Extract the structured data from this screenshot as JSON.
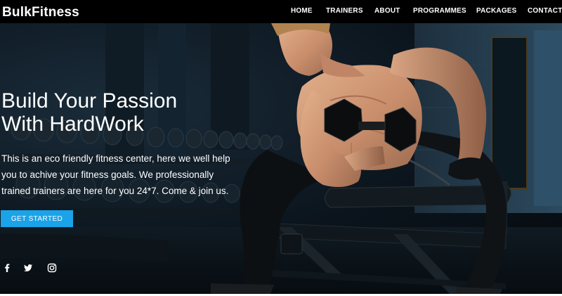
{
  "brand": {
    "name": "BulkFitness"
  },
  "nav": {
    "items": [
      {
        "label": "HOME"
      },
      {
        "label": "TRAINERS"
      },
      {
        "label": "ABOUT"
      },
      {
        "label": "PROGRAMMES"
      },
      {
        "label": "PACKAGES"
      },
      {
        "label": "CONTACT"
      }
    ]
  },
  "hero": {
    "title_line1": "Build Your Passion",
    "title_line2": "With HardWork",
    "text": "This is an eco friendly fitness center, here we well help you to achive your fitness goals. We professionally trained trainers are here for you 24*7. Come & join us.",
    "cta_label": "GET STARTED",
    "image_icon": "man-lifting-dumbbell-photo"
  },
  "social": {
    "icons": [
      "facebook-icon",
      "twitter-icon",
      "instagram-icon"
    ]
  },
  "colors": {
    "nav_background": "#000000",
    "accent": "#1aa3e8",
    "text": "#ffffff"
  }
}
